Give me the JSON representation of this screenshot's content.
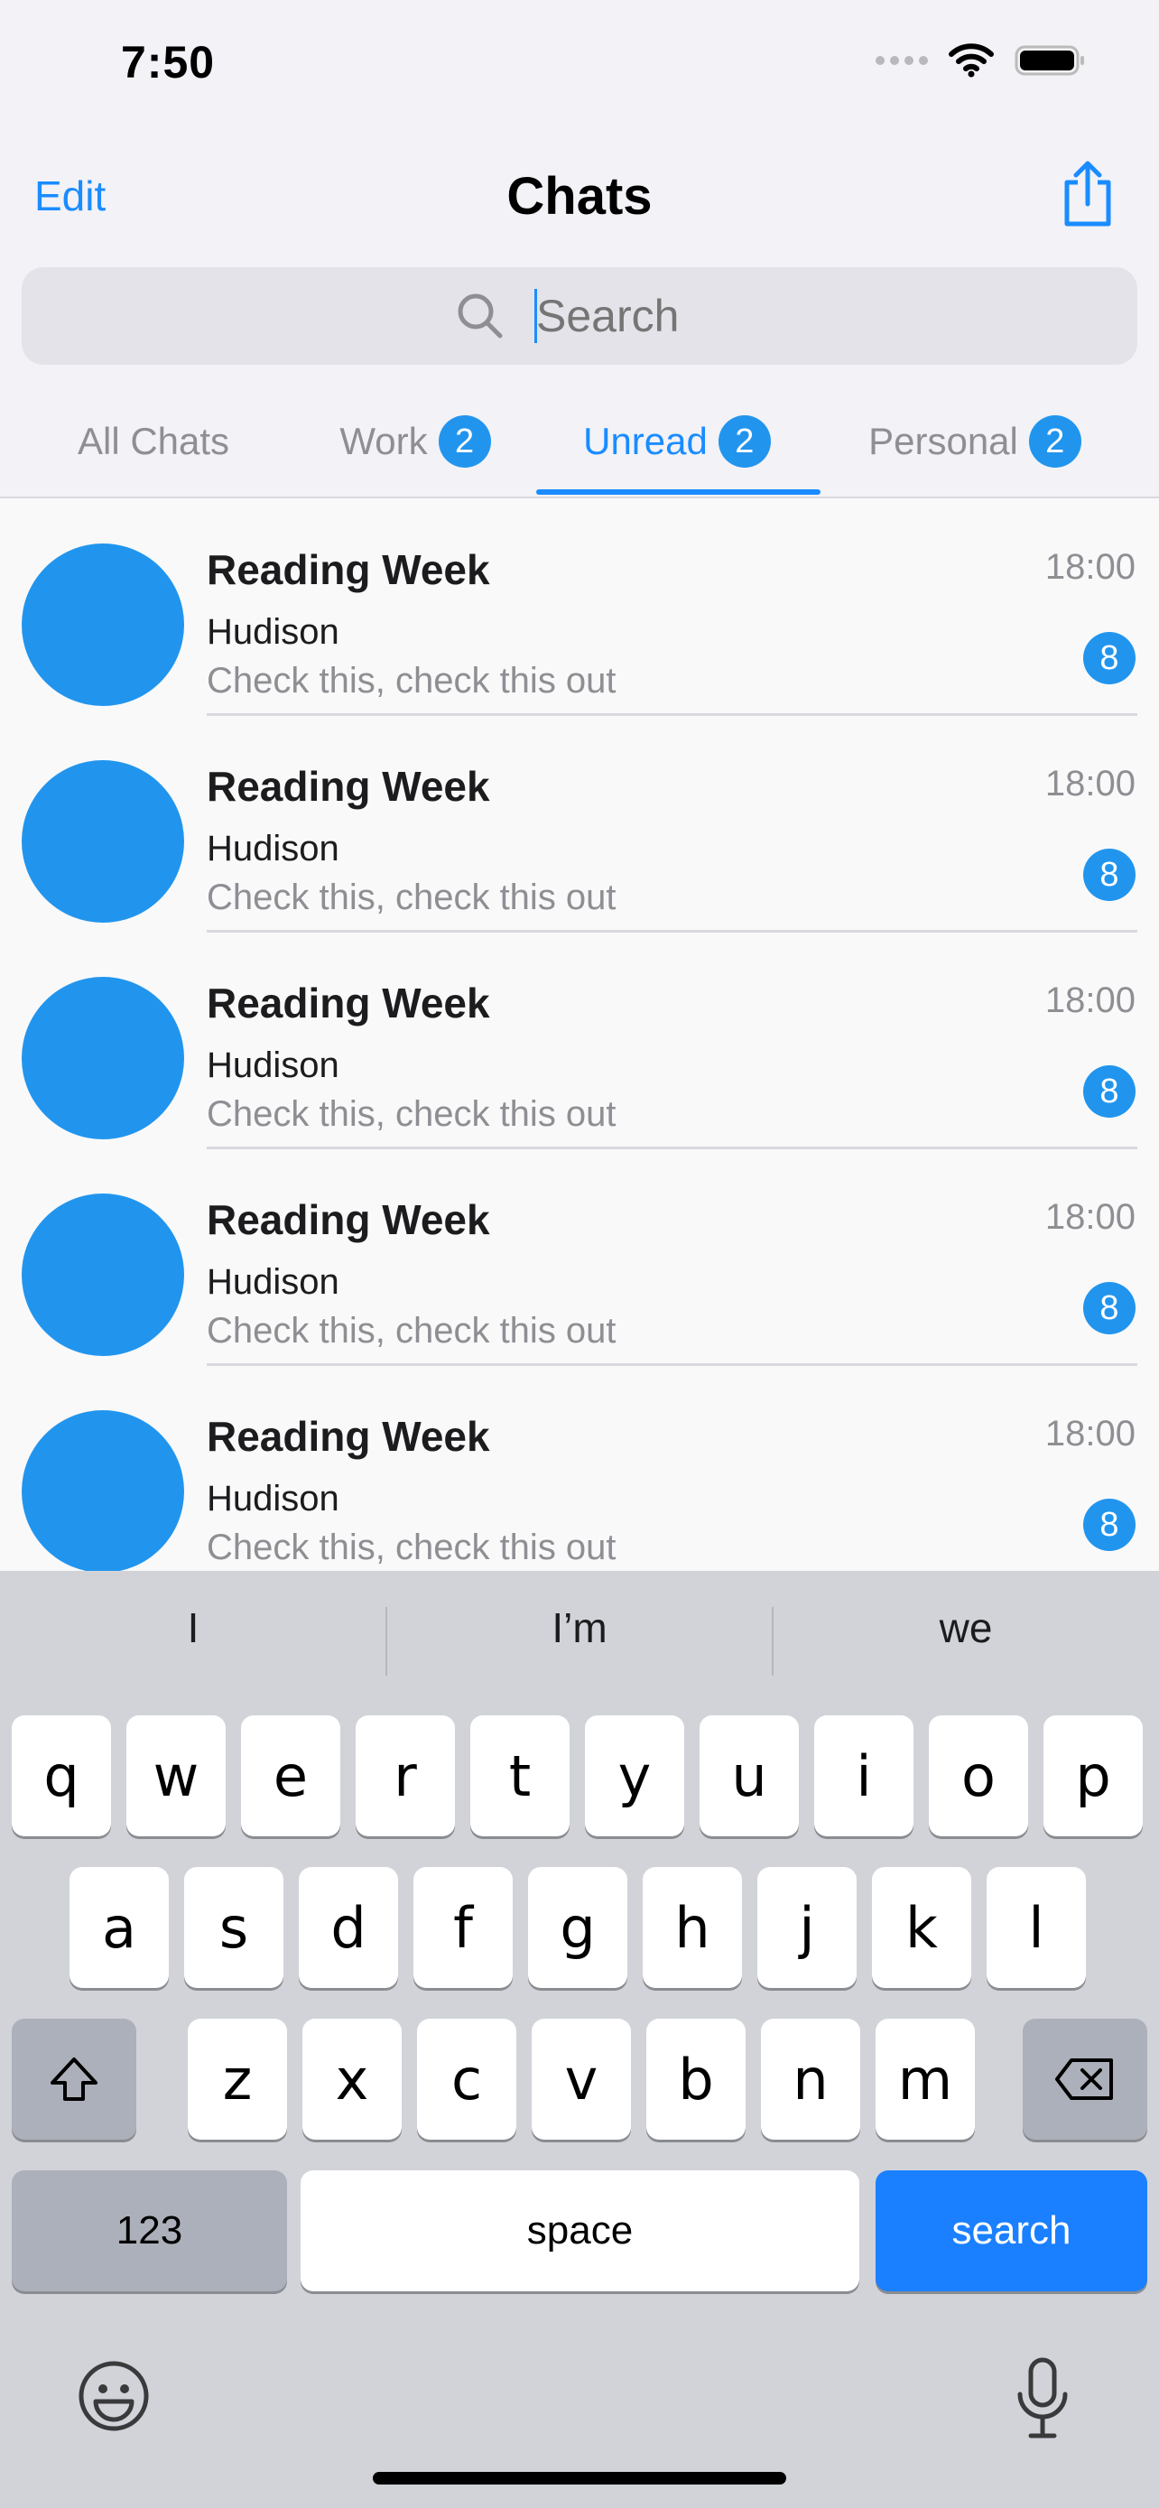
{
  "status_bar": {
    "time": "7:50"
  },
  "nav": {
    "edit_label": "Edit",
    "title": "Chats"
  },
  "search": {
    "placeholder": "Search"
  },
  "tabs": [
    {
      "label": "All Chats",
      "badge": ""
    },
    {
      "label": "Work",
      "badge": "2"
    },
    {
      "label": "Unread",
      "badge": "2"
    },
    {
      "label": "Personal",
      "badge": "2"
    }
  ],
  "active_tab": "Unread",
  "chats": [
    {
      "title": "Reading Week",
      "time": "18:00",
      "sender": "Hudison",
      "preview": "Check this, check this out",
      "unread": "8"
    },
    {
      "title": "Reading Week",
      "time": "18:00",
      "sender": "Hudison",
      "preview": "Check this, check this out",
      "unread": "8"
    },
    {
      "title": "Reading Week",
      "time": "18:00",
      "sender": "Hudison",
      "preview": "Check this, check this out",
      "unread": "8"
    },
    {
      "title": "Reading Week",
      "time": "18:00",
      "sender": "Hudison",
      "preview": "Check this, check this out",
      "unread": "8"
    },
    {
      "title": "Reading Week",
      "time": "18:00",
      "sender": "Hudison",
      "preview": "Check this, check this out",
      "unread": "8"
    }
  ],
  "keyboard": {
    "suggestions": [
      "I",
      "I’m",
      "we"
    ],
    "row1": [
      "q",
      "w",
      "e",
      "r",
      "t",
      "y",
      "u",
      "i",
      "o",
      "p"
    ],
    "row2": [
      "a",
      "s",
      "d",
      "f",
      "g",
      "h",
      "j",
      "k",
      "l"
    ],
    "row3": [
      "z",
      "x",
      "c",
      "v",
      "b",
      "n",
      "m"
    ],
    "numbers_label": "123",
    "space_label": "space",
    "search_label": "search"
  },
  "colors": {
    "accent": "#1a8cff",
    "avatar": "#2195ee",
    "badge": "#2195ee",
    "keyboard_bg": "#d1d3d9",
    "search_key": "#1a80ff"
  }
}
